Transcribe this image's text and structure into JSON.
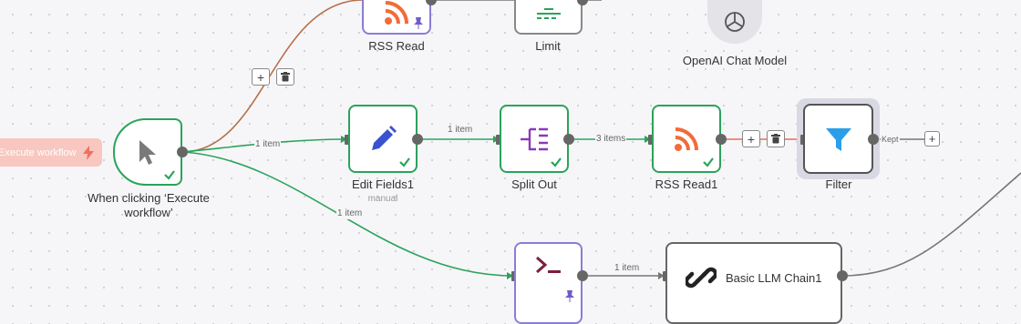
{
  "trigger": {
    "execute_label": "Execute workflow",
    "label": "When clicking ‘Execute workflow’"
  },
  "nodes": {
    "rss_read": {
      "label": "RSS Read"
    },
    "limit": {
      "label": "Limit"
    },
    "openai": {
      "label": "OpenAI Chat Model"
    },
    "edit_fields": {
      "label": "Edit Fields1",
      "sub": "manual"
    },
    "split_out": {
      "label": "Split Out"
    },
    "rss_read1": {
      "label": "RSS Read1"
    },
    "filter": {
      "label": "Filter"
    },
    "llm_chain": {
      "label": "Basic LLM Chain1"
    }
  },
  "edges": {
    "trigger_to_edit": "1 item",
    "trigger_to_code": "1 item",
    "edit_to_split": "1 item",
    "split_to_rss": "3 items",
    "code_to_llm": "1 item",
    "filter_out": "Kept"
  },
  "colors": {
    "success": "#2aa35a",
    "rss": "#f26b3a",
    "filter": "#2a9ee8",
    "split": "#8b3ab8",
    "code": "#7a1f3d",
    "wire_orange": "#b5714a",
    "wire_red": "#e86a5e"
  }
}
